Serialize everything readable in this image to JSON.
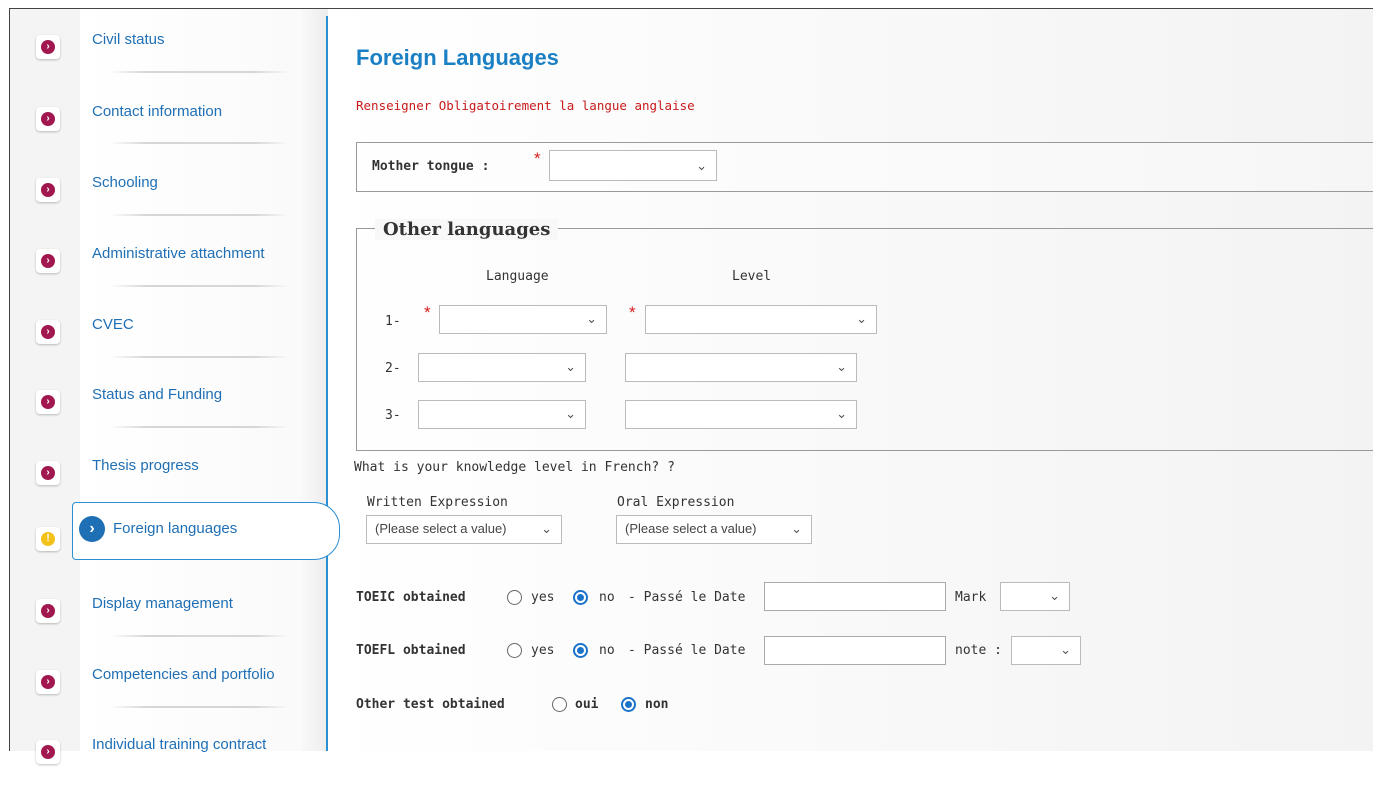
{
  "sidebar": {
    "items": [
      {
        "label": "Civil status",
        "status": "pending"
      },
      {
        "label": "Contact information",
        "status": "pending"
      },
      {
        "label": "Schooling",
        "status": "pending"
      },
      {
        "label": "Administrative attachment",
        "status": "pending"
      },
      {
        "label": "CVEC",
        "status": "pending"
      },
      {
        "label": "Status and Funding",
        "status": "pending"
      },
      {
        "label": "Thesis progress",
        "status": "pending"
      },
      {
        "label": "Foreign languages",
        "status": "warning",
        "active": true
      },
      {
        "label": "Display management",
        "status": "pending"
      },
      {
        "label": "Competencies and portfolio",
        "status": "pending"
      },
      {
        "label": "Individual training contract",
        "status": "pending"
      }
    ]
  },
  "main": {
    "title": "Foreign Languages",
    "warning": "Renseigner Obligatoirement la langue anglaise",
    "mother_tongue": {
      "label": "Mother tongue :",
      "required": "*",
      "value": ""
    },
    "other_languages": {
      "legend": "Other languages",
      "col_language": "Language",
      "col_level": "Level",
      "rows": [
        {
          "index": "1-",
          "required": "*",
          "language": "",
          "level": ""
        },
        {
          "index": "2-",
          "language": "",
          "level": ""
        },
        {
          "index": "3-",
          "language": "",
          "level": ""
        }
      ]
    },
    "french": {
      "question": "What is your knowledge level in French? ?",
      "written_label": "Written Expression",
      "written_value": "(Please select a value)",
      "oral_label": "Oral Expression",
      "oral_value": "(Please select a value)"
    },
    "toeic": {
      "label": "TOEIC obtained",
      "yes": "yes",
      "no": "no",
      "selected": "no",
      "date_label": "- Passé le Date",
      "date_value": "",
      "mark_label": "Mark",
      "mark_value": ""
    },
    "toefl": {
      "label": "TOEFL obtained",
      "yes": "yes",
      "no": "no",
      "selected": "no",
      "date_label": "- Passé le Date",
      "date_value": "",
      "mark_label": "note :",
      "mark_value": ""
    },
    "other_test": {
      "label": "Other test obtained",
      "yes": "oui",
      "no": "non",
      "selected": "non"
    }
  },
  "icons": {
    "pending": "chevron-right-icon",
    "warning": "exclamation-icon",
    "active": "arrow-right-icon"
  },
  "colors": {
    "accent": "#1b7fc4",
    "bullet": "#a0184f",
    "warning": "#f2c21a",
    "required": "#d42020"
  }
}
